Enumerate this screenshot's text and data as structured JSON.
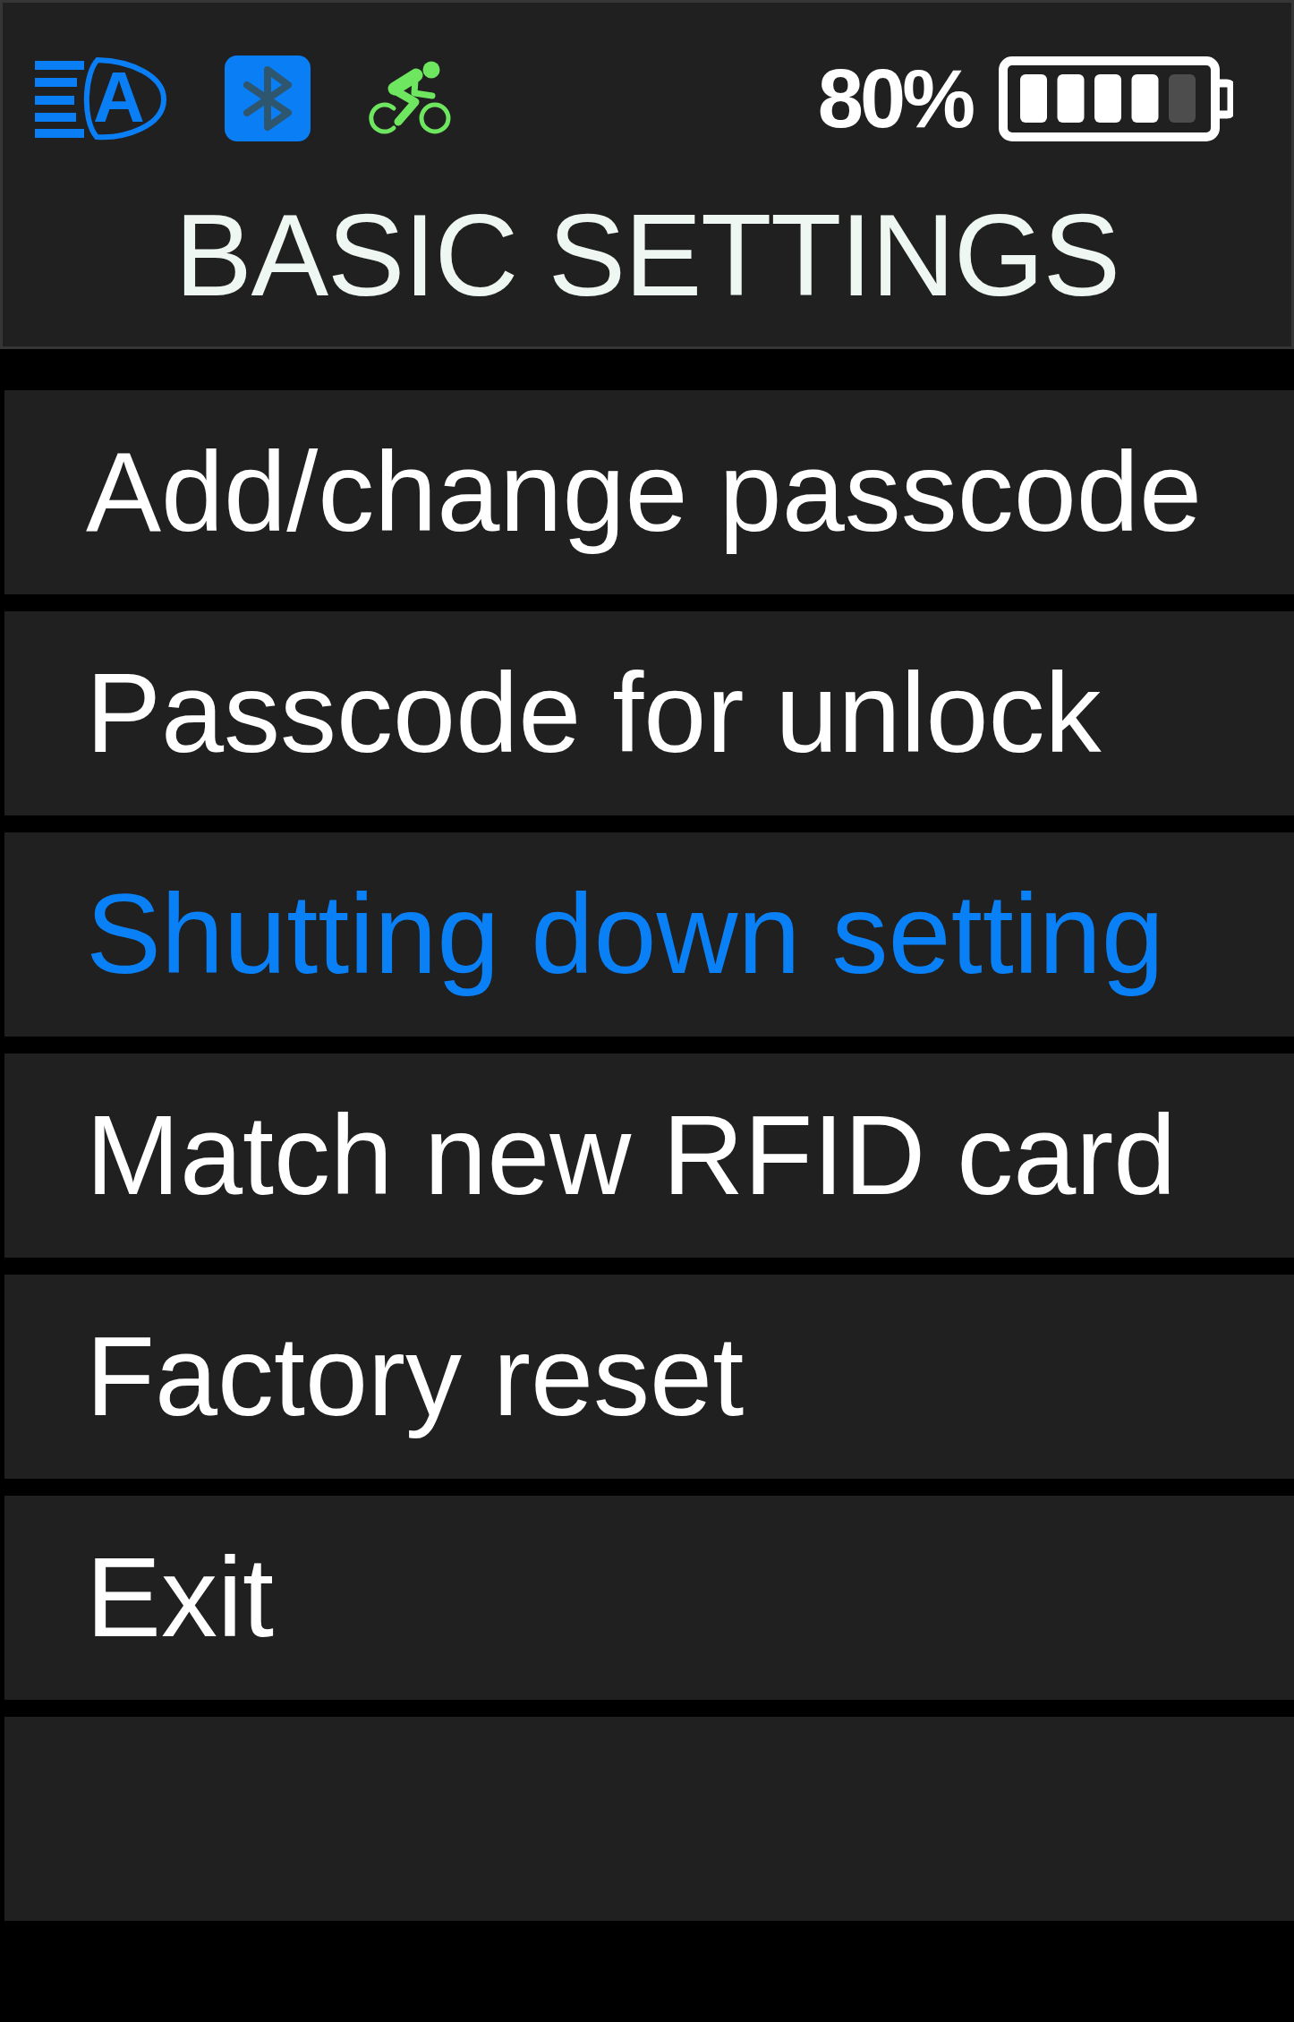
{
  "status_bar": {
    "headlight_mode": "A",
    "battery_percent": "80%"
  },
  "title": "BASIC SETTINGS",
  "menu": {
    "items": [
      {
        "label": "Add/change passcode",
        "selected": false
      },
      {
        "label": "Passcode for unlock",
        "selected": false
      },
      {
        "label": "Shutting down setting",
        "selected": true
      },
      {
        "label": "Match new RFID card",
        "selected": false
      },
      {
        "label": "Factory reset",
        "selected": false
      },
      {
        "label": "Exit",
        "selected": false
      }
    ]
  }
}
